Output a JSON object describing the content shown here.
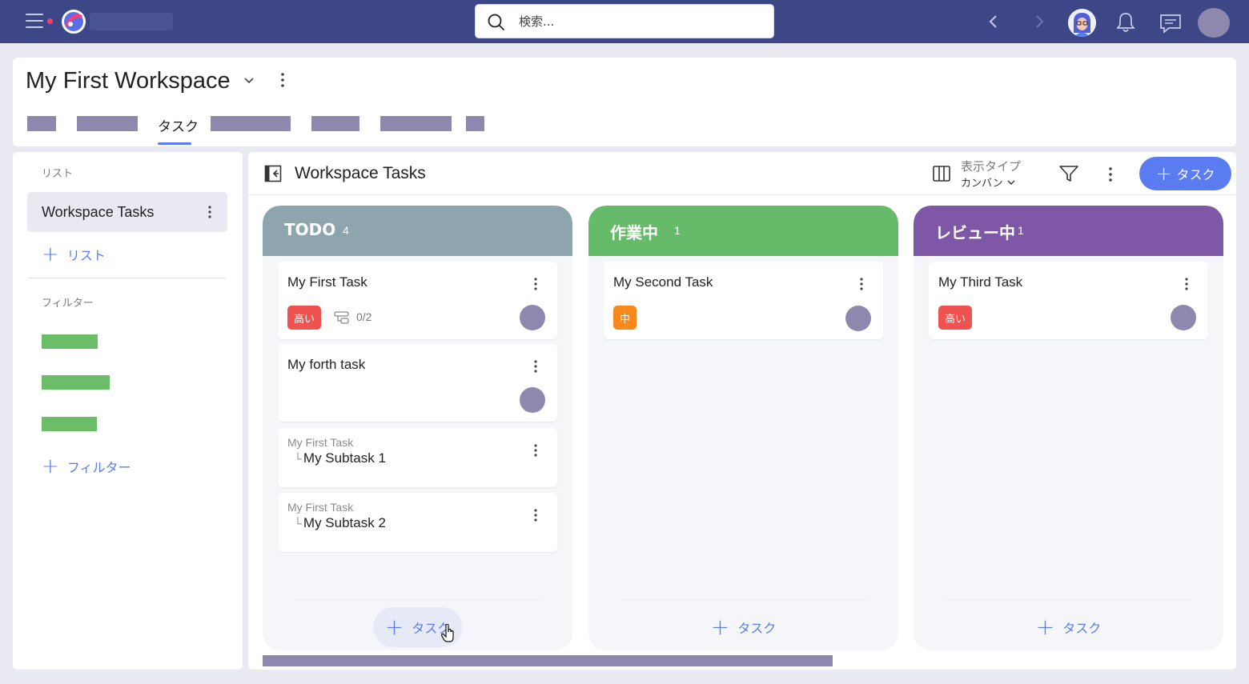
{
  "topbar": {
    "search_placeholder": "検索...",
    "icons": [
      "hamburger-menu-icon",
      "app-logo-icon",
      "search-icon",
      "chevron-left-icon",
      "chevron-right-icon",
      "bell-icon",
      "chat-icon"
    ]
  },
  "workspace": {
    "title": "My First Workspace",
    "active_tab": "タスク"
  },
  "sidebar": {
    "list_section_label": "リスト",
    "lists": [
      {
        "label": "Workspace Tasks"
      }
    ],
    "add_list_label": "リスト",
    "filter_section_label": "フィルター",
    "add_filter_label": "フィルター"
  },
  "main": {
    "title": "Workspace Tasks",
    "view_type_label": "表示タイプ",
    "view_type_value": "カンバン",
    "add_task_label": "タスク"
  },
  "columns": [
    {
      "title": "TODO",
      "count": "4",
      "color": "#8fa5ae",
      "add_label": "タスク",
      "cards": [
        {
          "title": "My First Task",
          "badge": "高い",
          "subtasks": "0/2"
        },
        {
          "title": "My forth task"
        },
        {
          "parent": "My First Task",
          "title": "My Subtask 1"
        },
        {
          "parent": "My First Task",
          "title": "My Subtask 2"
        }
      ]
    },
    {
      "title": "作業中",
      "count": "1",
      "color": "#66bb6a",
      "add_label": "タスク",
      "cards": [
        {
          "title": "My Second Task",
          "badge": "中"
        }
      ]
    },
    {
      "title": "レビュー中",
      "count": "1",
      "color": "#7e57a6",
      "add_label": "タスク",
      "cards": [
        {
          "title": "My Third Task",
          "badge": "高い"
        }
      ]
    }
  ],
  "colors": {
    "topbar": "#3d4787",
    "accent": "#5b7cf0",
    "priority_high": "#f0524f",
    "priority_mid": "#f7891c"
  }
}
